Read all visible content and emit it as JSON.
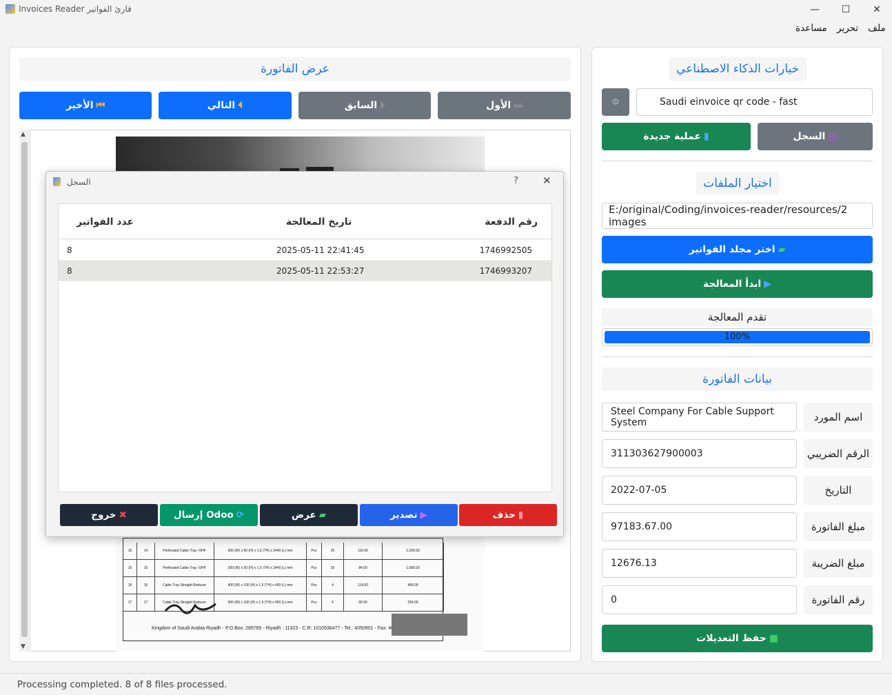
{
  "window": {
    "title": "Invoices Reader قارئ الفواتير",
    "minimize_glyph": "—",
    "maximize_glyph": "☐",
    "close_glyph": "✕"
  },
  "menubar": [
    "ملف",
    "تحرير",
    "مساعدة"
  ],
  "viewer": {
    "heading": "عرض الفاتورة",
    "nav": {
      "last": "الأخير",
      "next": "التالي",
      "prev": "السابق",
      "first": "الأول"
    },
    "doc_footer_line1": "Kingdom of Saudi Arabia Riyadh - P.O.Box: 285765 - Riyadh : 11323 - C.R: 1010536477 - Tel.: 4050901 - Fax: 4036050",
    "doc_rows": [
      {
        "n1": "16",
        "n2": "14",
        "desc": "Perforated Cable Tray -OHF",
        "spec": "300 (W) x 50 (H) x 1.5 (TH) x 2440 (L) mm",
        "unit": "Pcs",
        "qty": "20",
        "price": "110.00",
        "total": "2,200.00"
      },
      {
        "n1": "15",
        "n2": "15",
        "desc": "Perforated Cable Tray -OHF",
        "spec": "200 (W) x 50 (H) x 1.5 (TH) x 2440 (L) mm",
        "unit": "Pcs",
        "qty": "20",
        "price": "84.00",
        "total": "1,680.00"
      },
      {
        "n1": "16",
        "n2": "16",
        "desc": "Cable Tray Straight Reducer",
        "spec": "400 (W) x 100 (H) x 1.5 (TH) x 450 (L) mm",
        "unit": "Pcs",
        "qty": "4",
        "price": "114.00",
        "total": "456.00"
      },
      {
        "n1": "17",
        "n2": "17",
        "desc": "Cable Tray Straight Reducer",
        "spec": "300 (W) x 100 (H) x 1.5 (TH) x 450 (L) mm",
        "unit": "Pcs",
        "qty": "4",
        "price": "66.00",
        "total": "264.00"
      }
    ]
  },
  "ai": {
    "heading": "خيارات الذكاء الاصطناعي",
    "model": "Saudi einvoice qr code - fast",
    "history_button": "السجل",
    "new_button": "عملية جديدة"
  },
  "files": {
    "heading": "اختيار الملفات",
    "path": "E:/original/Coding/invoices-reader/resources/2 images",
    "choose_button": "اختر مجلد الفواتير",
    "start_button": "ابدأ المعالجة",
    "progress_label": "تقدم المعالجة",
    "progress_text": "100%",
    "progress_value": 1.0
  },
  "invoice": {
    "heading": "بيانات الفاتورة",
    "fields": [
      {
        "label": "اسم المورد",
        "value": "Steel Company  For Cable Support System"
      },
      {
        "label": "الرقم الضريبي",
        "value": "311303627900003"
      },
      {
        "label": "التاريخ",
        "value": "2022-07-05"
      },
      {
        "label": "مبلغ الفاتورة",
        "value": "97183.67.00"
      },
      {
        "label": "مبلغ الضريبة",
        "value": "12676.13"
      },
      {
        "label": "رقم الفاتورة",
        "value": "0"
      }
    ],
    "save_button": "حفظ التعديلات"
  },
  "dialog": {
    "title": "السجل",
    "help": "?",
    "close": "✕",
    "columns": [
      "رقم الدفعة",
      "تاريخ المعالجة",
      "عدد الفواتير"
    ],
    "rows": [
      {
        "batch": "1746992505",
        "date": "2025-05-11 22:41:45",
        "count": "8"
      },
      {
        "batch": "1746993207",
        "date": "2025-05-11 22:53:27",
        "count": "8"
      }
    ],
    "buttons": {
      "delete": "حذف",
      "export": "تصدير",
      "view": "عرض",
      "odoo": "إرسال Odoo",
      "exit": "خروج"
    }
  },
  "status": "Processing completed. 8 of 8 files processed.",
  "colors": {
    "primary": "#0d6efd",
    "secondary": "#6c757d",
    "success": "#198754",
    "danger": "#dc2626",
    "dark": "#1f2937",
    "export": "#2563eb",
    "odoo": "#059669",
    "heading": "#1a73e8"
  }
}
